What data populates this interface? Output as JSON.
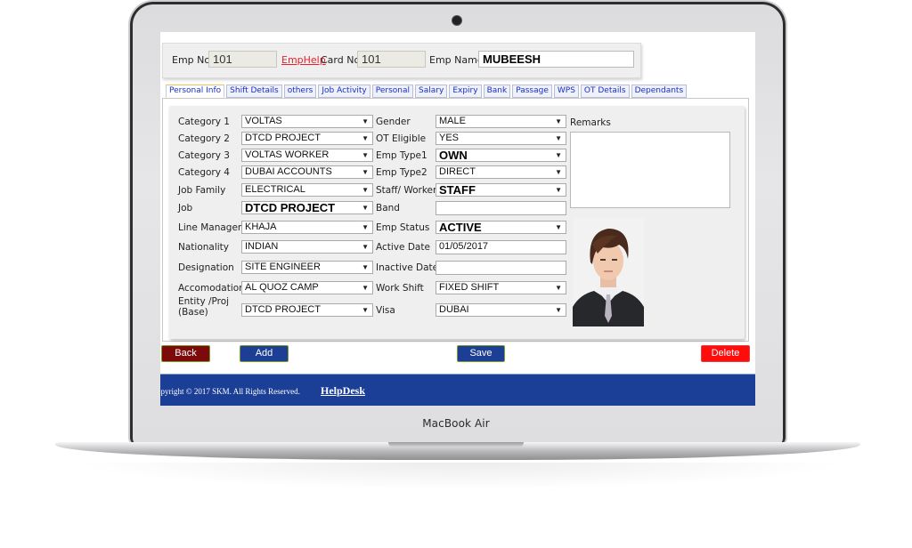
{
  "device": {
    "brand_label": "MacBook Air"
  },
  "header": {
    "emp_no_label": "Emp No",
    "emp_no_value": "101",
    "emphelp_link": "EmpHelp",
    "card_no_label": "Card No",
    "card_no_value": "101",
    "emp_name_label": "Emp Name",
    "emp_name_value": "MUBEESH"
  },
  "tabs": [
    {
      "label": "Personal Info",
      "active": true
    },
    {
      "label": "Shift Details"
    },
    {
      "label": "others"
    },
    {
      "label": "Job Activity"
    },
    {
      "label": "Personal"
    },
    {
      "label": "Salary"
    },
    {
      "label": "Expiry"
    },
    {
      "label": "Bank"
    },
    {
      "label": "Passage"
    },
    {
      "label": "WPS"
    },
    {
      "label": "OT Details"
    },
    {
      "label": "Dependants"
    }
  ],
  "form": {
    "left": [
      {
        "label": "Category 1",
        "value": "VOLTAS"
      },
      {
        "label": "Category 2",
        "value": "DTCD PROJECT"
      },
      {
        "label": "Category 3",
        "value": "VOLTAS WORKER"
      },
      {
        "label": "Category 4",
        "value": "DUBAI ACCOUNTS"
      },
      {
        "label": "Job Family",
        "value": "ELECTRICAL"
      },
      {
        "label": "Job",
        "value": "DTCD PROJECT"
      },
      {
        "label": "Line Manager",
        "value": "KHAJA"
      },
      {
        "label": "Nationality",
        "value": "INDIAN"
      },
      {
        "label": "Designation",
        "value": "SITE ENGINEER"
      },
      {
        "label": "Accomodation",
        "value": "AL QUOZ CAMP"
      },
      {
        "label": "Entity /Proj (Base)",
        "label_line1": "Entity /Proj",
        "label_line2": "(Base)",
        "value": "DTCD PROJECT"
      }
    ],
    "right": [
      {
        "label": "Gender",
        "value": "MALE"
      },
      {
        "label": "OT Eligible",
        "value": "YES"
      },
      {
        "label": "Emp Type1",
        "value": "OWN"
      },
      {
        "label": "Emp Type2",
        "value": "DIRECT"
      },
      {
        "label": "Staff/ Worker",
        "value": "STAFF"
      },
      {
        "label": "Band",
        "value": ""
      },
      {
        "label": "Emp Status",
        "value": "ACTIVE"
      },
      {
        "label": "Active Date",
        "value": "01/05/2017"
      },
      {
        "label": "Inactive Date",
        "value": ""
      },
      {
        "label": "Work Shift",
        "value": "FIXED SHIFT"
      },
      {
        "label": "Visa",
        "value": "DUBAI"
      }
    ],
    "remarks_label": "Remarks",
    "remarks_value": "",
    "caret": "▼"
  },
  "buttons": {
    "back": "Back",
    "add": "Add",
    "save": "Save",
    "delete": "Delete"
  },
  "colors": {
    "back": "#7d0a0a",
    "add": "#1c3e94",
    "save": "#1c3e94",
    "delete": "#ff0d0d",
    "footer": "#1b3e96"
  },
  "footer": {
    "copyright": "opyright © 2017 SKM. All Rights Reserved.",
    "helpdesk": "HelpDesk"
  }
}
